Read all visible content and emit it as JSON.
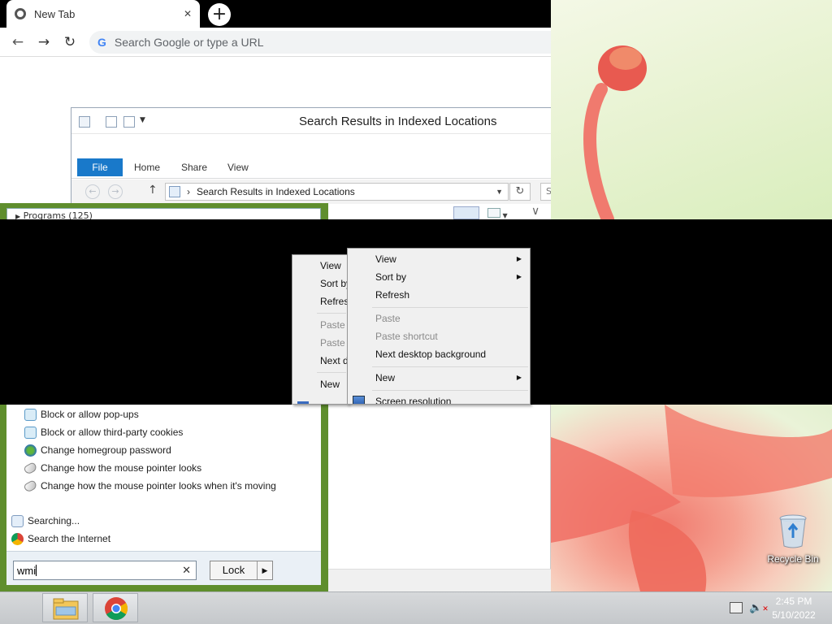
{
  "browser": {
    "tab_title": "New Tab",
    "tab_close": "✕",
    "new_tab": "+",
    "omnibox_placeholder": "Search Google or type a URL",
    "omnibox_logo": "G",
    "nav": {
      "back": "←",
      "forward": "→",
      "reload": "↻"
    }
  },
  "explorer": {
    "title": "Search Results in Indexed Locations",
    "ribbon_tabs": [
      "File",
      "Home",
      "Share",
      "View"
    ],
    "address": "Search Results in Indexed Locations",
    "address_sep": "›",
    "search_cut": "S"
  },
  "start_search": {
    "group_header": "Programs (125)",
    "results": [
      {
        "label": "Block or allow pop-ups",
        "icon": "internet-options-icon"
      },
      {
        "label": "Block or allow third-party cookies",
        "icon": "internet-options-icon"
      },
      {
        "label": "Change homegroup password",
        "icon": "homegroup-icon"
      },
      {
        "label": "Change how the mouse pointer looks",
        "icon": "mouse-icon"
      },
      {
        "label": "Change how the mouse pointer looks when it's moving",
        "icon": "mouse-icon"
      }
    ],
    "searching": "Searching...",
    "search_internet": "Search the Internet",
    "query": "wmi",
    "clear": "✕",
    "lock_label": "Lock",
    "lock_arrow": "▶"
  },
  "context_menu_back": {
    "items": [
      "View",
      "Sort by",
      "Refresh",
      "Paste",
      "Paste shortcut",
      "Next desktop background",
      "New"
    ]
  },
  "context_menu": {
    "view": "View",
    "sort_by": "Sort by",
    "refresh": "Refresh",
    "paste": "Paste",
    "paste_shortcut": "Paste shortcut",
    "next_bg": "Next desktop background",
    "new": "New",
    "screen_resolution": "Screen resolution",
    "submenu_arrow": "▶"
  },
  "desktop": {
    "recycle_bin": "Recycle Bin"
  },
  "taskbar": {
    "time": "2:45 PM",
    "date": "5/10/2022"
  },
  "colors": {
    "start_border": "#5f8e2d",
    "file_tab": "#1979ca",
    "black_band": "#000000"
  }
}
